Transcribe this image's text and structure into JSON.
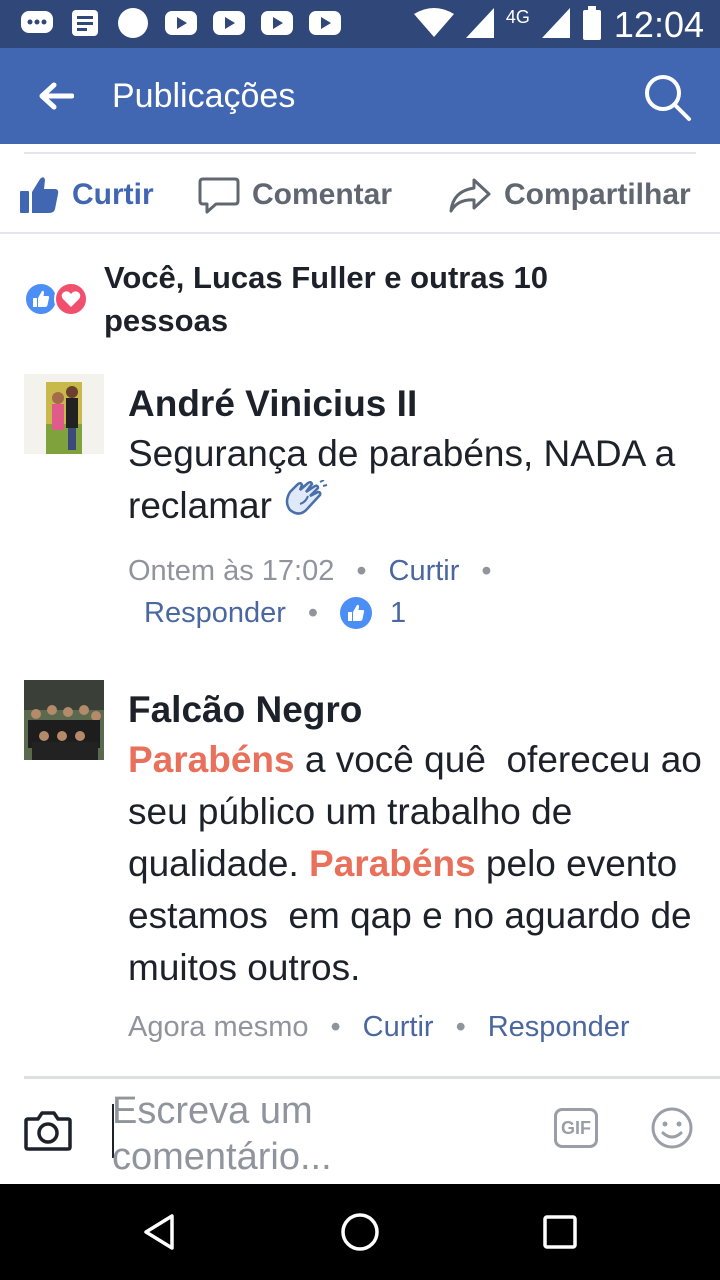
{
  "status_bar": {
    "time": "12:04",
    "network": "4G",
    "icons": [
      "messages-icon",
      "news-icon",
      "circle-icon",
      "youtube-icon",
      "youtube-icon",
      "youtube-icon",
      "youtube-icon",
      "wifi-icon",
      "signal-icon",
      "signal-icon",
      "battery-icon"
    ]
  },
  "app_bar": {
    "title": "Publicações",
    "back_icon": "arrow-back-icon",
    "search_icon": "search-icon",
    "color": "#4267b2"
  },
  "actions": {
    "like_label": "Curtir",
    "comment_label": "Comentar",
    "share_label": "Compartilhar"
  },
  "reactions": {
    "summary": "Você, Lucas Fuller e outras 10 pessoas",
    "icons": [
      "like-reaction-icon",
      "love-reaction-icon"
    ]
  },
  "comments": [
    {
      "author": "André Vinicius II",
      "text": "Segurança de parabéns, NADA a reclamar",
      "emoji": "clapping-hands-icon",
      "time": "Ontem às 17:02",
      "like_label": "Curtir",
      "reply_label": "Responder",
      "like_count": "1"
    },
    {
      "author": "Falcão Negro",
      "text_parts": [
        "Parabéns",
        " a você quê  ofereceu ao seu público um trabalho de qualidade. ",
        "Parabéns",
        " pelo evento estamos  em qap e no aguardo de muitos outros."
      ],
      "time": "Agora mesmo",
      "like_label": "Curtir",
      "reply_label": "Responder"
    }
  ],
  "composer": {
    "placeholder": "Escreva um comentário...",
    "camera_icon": "camera-icon",
    "gif_label": "GIF",
    "emoji_icon": "smiley-icon"
  },
  "nav_bar": {
    "icons": [
      "back-triangle-icon",
      "home-circle-icon",
      "recents-square-icon"
    ]
  },
  "colors": {
    "status_bar": "#2f4779",
    "accent": "#4267b2",
    "highlight": "#e9705a",
    "meta": "#90949c"
  }
}
